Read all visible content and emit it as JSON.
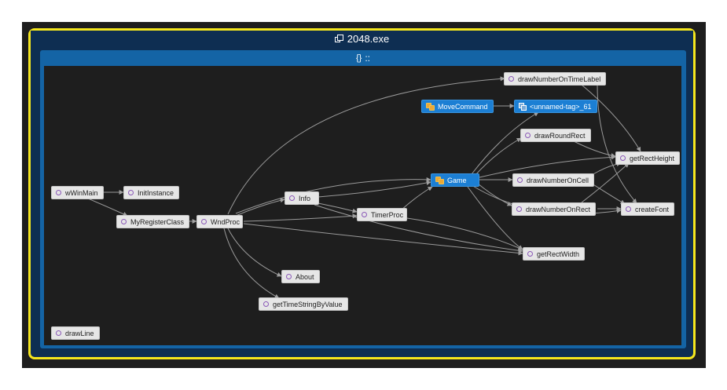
{
  "assembly": {
    "title": "2048.exe",
    "icon": "assembly-icon"
  },
  "namespace": {
    "title": "::",
    "icon": "namespace-braces-icon"
  },
  "nodes": {
    "drawNumberOnTimeLabel": "drawNumberOnTimeLabel",
    "MoveCommand": "MoveCommand",
    "unnamed_tag": "<unnamed-tag>_61",
    "drawRoundRect": "drawRoundRect",
    "getRectHeight": "getRectHeight",
    "wWinMain": "wWinMain",
    "InitInstance": "InitInstance",
    "Game": "Game",
    "drawNumberOnCell": "drawNumberOnCell",
    "Info": "Info",
    "drawNumberOnRect": "drawNumberOnRect",
    "createFont": "createFont",
    "TimerProc": "TimerProc",
    "MyRegisterClass": "MyRegisterClass",
    "WndProc": "WndProc",
    "getRectWidth": "getRectWidth",
    "About": "About",
    "getTimeStringByValue": "getTimeStringByValue",
    "drawLine": "drawLine"
  },
  "colors": {
    "selection_border": "#f5e61d",
    "assembly_bg": "#0e2e52",
    "namespace_bg": "#1464a5",
    "canvas_bg": "#1e1e1e",
    "class_node": "#1c7fd4",
    "function_node": "#e6e6e6",
    "edge": "#a0a0a0"
  }
}
